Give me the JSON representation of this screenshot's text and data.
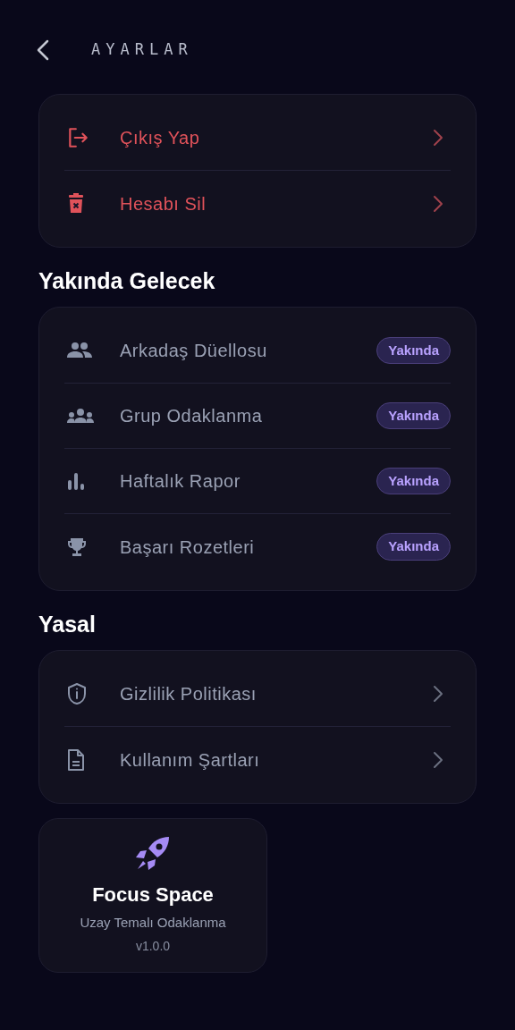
{
  "header": {
    "title": "AYARLAR"
  },
  "account_actions": [
    {
      "label": "Çıkış Yap",
      "kind": "danger"
    },
    {
      "label": "Hesabı Sil",
      "kind": "danger"
    }
  ],
  "sections": [
    {
      "title": "Yakında Gelecek",
      "items": [
        {
          "label": "Arkadaş Düellosu",
          "kind": "soon",
          "badge": "Yakında"
        },
        {
          "label": "Grup Odaklanma",
          "kind": "soon",
          "badge": "Yakında"
        },
        {
          "label": "Haftalık Rapor",
          "kind": "soon",
          "badge": "Yakında"
        },
        {
          "label": "Başarı Rozetleri",
          "kind": "soon",
          "badge": "Yakında"
        }
      ]
    },
    {
      "title": "Yasal",
      "items": [
        {
          "label": "Gizlilik Politikası",
          "kind": "link"
        },
        {
          "label": "Kullanım Şartları",
          "kind": "link"
        }
      ]
    }
  ],
  "app_info": {
    "name": "Focus Space",
    "tagline": "Uzay Temalı Odaklanma",
    "version": "v1.0.0"
  }
}
